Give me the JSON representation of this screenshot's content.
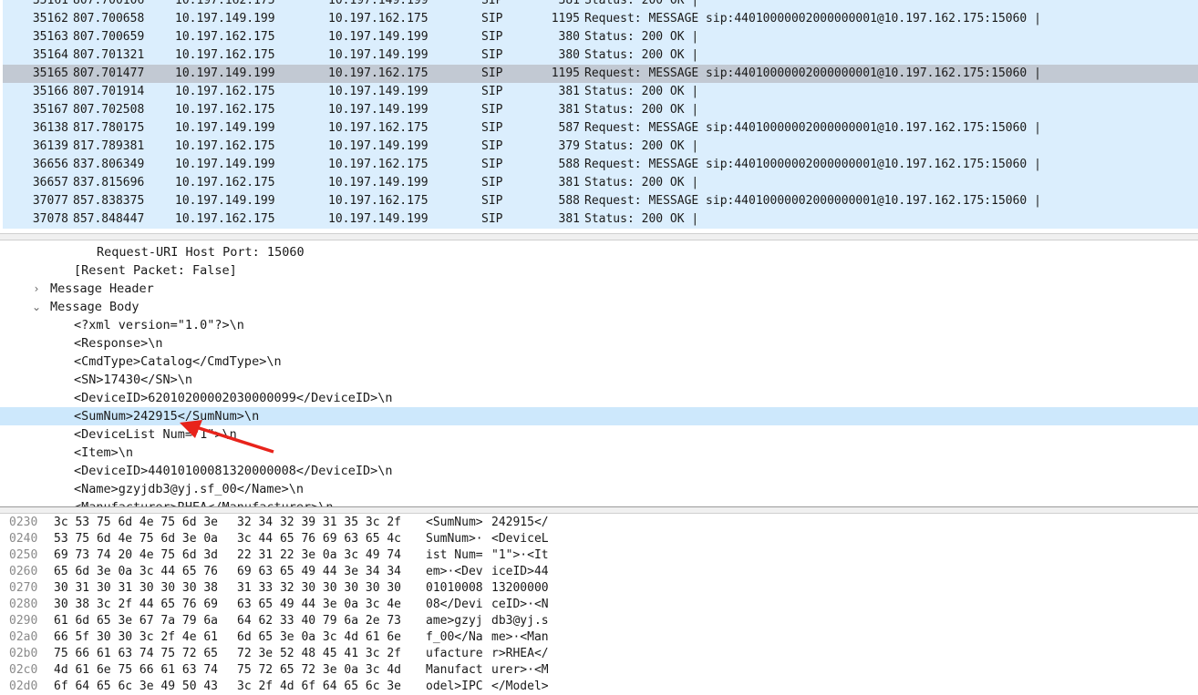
{
  "packets": [
    {
      "no": "35161",
      "time": "807.700106",
      "src": "10.197.162.175",
      "dst": "10.197.149.199",
      "proto": "SIP",
      "len": "381",
      "info": "Status: 200 OK |"
    },
    {
      "no": "35162",
      "time": "807.700658",
      "src": "10.197.149.199",
      "dst": "10.197.162.175",
      "proto": "SIP",
      "len": "1195",
      "info": "Request: MESSAGE sip:44010000002000000001@10.197.162.175:15060 |"
    },
    {
      "no": "35163",
      "time": "807.700659",
      "src": "10.197.162.175",
      "dst": "10.197.149.199",
      "proto": "SIP",
      "len": "380",
      "info": "Status: 200 OK |"
    },
    {
      "no": "35164",
      "time": "807.701321",
      "src": "10.197.162.175",
      "dst": "10.197.149.199",
      "proto": "SIP",
      "len": "380",
      "info": "Status: 200 OK |"
    },
    {
      "no": "35165",
      "time": "807.701477",
      "src": "10.197.149.199",
      "dst": "10.197.162.175",
      "proto": "SIP",
      "len": "1195",
      "info": "Request: MESSAGE sip:44010000002000000001@10.197.162.175:15060 |",
      "selected": true
    },
    {
      "no": "35166",
      "time": "807.701914",
      "src": "10.197.162.175",
      "dst": "10.197.149.199",
      "proto": "SIP",
      "len": "381",
      "info": "Status: 200 OK |"
    },
    {
      "no": "35167",
      "time": "807.702508",
      "src": "10.197.162.175",
      "dst": "10.197.149.199",
      "proto": "SIP",
      "len": "381",
      "info": "Status: 200 OK |"
    },
    {
      "no": "36138",
      "time": "817.780175",
      "src": "10.197.149.199",
      "dst": "10.197.162.175",
      "proto": "SIP",
      "len": "587",
      "info": "Request: MESSAGE sip:44010000002000000001@10.197.162.175:15060 |"
    },
    {
      "no": "36139",
      "time": "817.789381",
      "src": "10.197.162.175",
      "dst": "10.197.149.199",
      "proto": "SIP",
      "len": "379",
      "info": "Status: 200 OK |"
    },
    {
      "no": "36656",
      "time": "837.806349",
      "src": "10.197.149.199",
      "dst": "10.197.162.175",
      "proto": "SIP",
      "len": "588",
      "info": "Request: MESSAGE sip:44010000002000000001@10.197.162.175:15060 |"
    },
    {
      "no": "36657",
      "time": "837.815696",
      "src": "10.197.162.175",
      "dst": "10.197.149.199",
      "proto": "SIP",
      "len": "381",
      "info": "Status: 200 OK |"
    },
    {
      "no": "37077",
      "time": "857.838375",
      "src": "10.197.149.199",
      "dst": "10.197.162.175",
      "proto": "SIP",
      "len": "588",
      "info": "Request: MESSAGE sip:44010000002000000001@10.197.162.175:15060 |"
    },
    {
      "no": "37078",
      "time": "857.848447",
      "src": "10.197.162.175",
      "dst": "10.197.149.199",
      "proto": "SIP",
      "len": "381",
      "info": "Status: 200 OK |"
    }
  ],
  "details": [
    {
      "text": "Request-URI Host Port: 15060",
      "indent": 3
    },
    {
      "text": "[Resent Packet: False]",
      "indent": 2
    },
    {
      "text": "Message Header",
      "indent": 1,
      "toggle": "collapsed"
    },
    {
      "text": "Message Body",
      "indent": 1,
      "toggle": "expanded"
    },
    {
      "text": "<?xml version=\"1.0\"?>\\n",
      "indent": 2
    },
    {
      "text": "<Response>\\n",
      "indent": 2
    },
    {
      "text": "<CmdType>Catalog</CmdType>\\n",
      "indent": 2
    },
    {
      "text": "<SN>17430</SN>\\n",
      "indent": 2
    },
    {
      "text": "<DeviceID>62010200002030000099</DeviceID>\\n",
      "indent": 2
    },
    {
      "text": "<SumNum>242915</SumNum>\\n",
      "indent": 2,
      "highlight": true
    },
    {
      "text": "<DeviceList Num=\"1\">\\n",
      "indent": 2
    },
    {
      "text": "<Item>\\n",
      "indent": 2
    },
    {
      "text": "<DeviceID>44010100081320000008</DeviceID>\\n",
      "indent": 2
    },
    {
      "text": "<Name>gzyjdb3@yj.sf_00</Name>\\n",
      "indent": 2
    },
    {
      "text": "<Manufacturer>RHEA</Manufacturer>\\n",
      "indent": 2
    }
  ],
  "bytes": [
    {
      "off": "0230",
      "hex1": "3c 53 75 6d 4e 75 6d 3e",
      "hex2": "32 34 32 39 31 35 3c 2f",
      "asc1": "<SumNum>",
      "asc2": "242915</"
    },
    {
      "off": "0240",
      "hex1": "53 75 6d 4e 75 6d 3e 0a",
      "hex2": "3c 44 65 76 69 63 65 4c",
      "asc1": "SumNum>·",
      "asc2": "<DeviceL"
    },
    {
      "off": "0250",
      "hex1": "69 73 74 20 4e 75 6d 3d",
      "hex2": "22 31 22 3e 0a 3c 49 74",
      "asc1": "ist Num=",
      "asc2": "\"1\">·<It"
    },
    {
      "off": "0260",
      "hex1": "65 6d 3e 0a 3c 44 65 76",
      "hex2": "69 63 65 49 44 3e 34 34",
      "asc1": "em>·<Dev",
      "asc2": "iceID>44"
    },
    {
      "off": "0270",
      "hex1": "30 31 30 31 30 30 30 38",
      "hex2": "31 33 32 30 30 30 30 30",
      "asc1": "01010008",
      "asc2": "13200000"
    },
    {
      "off": "0280",
      "hex1": "30 38 3c 2f 44 65 76 69",
      "hex2": "63 65 49 44 3e 0a 3c 4e",
      "asc1": "08</Devi",
      "asc2": "ceID>·<N"
    },
    {
      "off": "0290",
      "hex1": "61 6d 65 3e 67 7a 79 6a",
      "hex2": "64 62 33 40 79 6a 2e 73",
      "asc1": "ame>gzyj",
      "asc2": "db3@yj.s"
    },
    {
      "off": "02a0",
      "hex1": "66 5f 30 30 3c 2f 4e 61",
      "hex2": "6d 65 3e 0a 3c 4d 61 6e",
      "asc1": "f_00</Na",
      "asc2": "me>·<Man"
    },
    {
      "off": "02b0",
      "hex1": "75 66 61 63 74 75 72 65",
      "hex2": "72 3e 52 48 45 41 3c 2f",
      "asc1": "ufacture",
      "asc2": "r>RHEA</"
    },
    {
      "off": "02c0",
      "hex1": "4d 61 6e 75 66 61 63 74",
      "hex2": "75 72 65 72 3e 0a 3c 4d",
      "asc1": "Manufact",
      "asc2": "urer>·<M"
    },
    {
      "off": "02d0",
      "hex1": "6f 64 65 6c 3e 49 50 43",
      "hex2": "3c 2f 4d 6f 64 65 6c 3e",
      "asc1": "odel>IPC",
      "asc2": "</Model>"
    }
  ],
  "colors": {
    "row_bg": "#dbeefd",
    "selected_row_bg": "#c2c9d3",
    "highlight_bg": "#cde8fc",
    "arrow": "#e8231b"
  },
  "icons": {
    "collapsed": "chevron-right-icon",
    "expanded": "chevron-down-icon"
  }
}
